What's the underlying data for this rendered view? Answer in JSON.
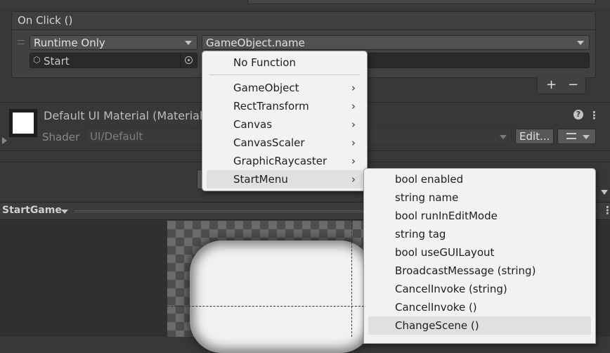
{
  "event": {
    "title": "On Click ()",
    "runtime_dropdown": "Runtime Only",
    "function_dropdown": "GameObject.name",
    "object_field": "Start",
    "add_button": "+",
    "remove_button": "−"
  },
  "material": {
    "title": "Default UI Material (Material)",
    "shader_label": "Shader",
    "shader_value": "UI/Default",
    "edit_button": "Edit..."
  },
  "scene": {
    "gameobject_dropdown": "StartGame"
  },
  "menu": {
    "items": [
      {
        "label": "No Function",
        "submenu": false
      },
      {
        "label": "GameObject",
        "submenu": true
      },
      {
        "label": "RectTransform",
        "submenu": true
      },
      {
        "label": "Canvas",
        "submenu": true
      },
      {
        "label": "CanvasScaler",
        "submenu": true
      },
      {
        "label": "GraphicRaycaster",
        "submenu": true
      },
      {
        "label": "StartMenu",
        "submenu": true,
        "highlighted": true
      }
    ]
  },
  "submenu": {
    "items": [
      {
        "label": "bool enabled"
      },
      {
        "label": "string name"
      },
      {
        "label": "bool runInEditMode"
      },
      {
        "label": "string tag"
      },
      {
        "label": "bool useGUILayout"
      },
      {
        "label": "BroadcastMessage (string)"
      },
      {
        "label": "CancelInvoke (string)"
      },
      {
        "label": "CancelInvoke ()"
      },
      {
        "label": "ChangeScene ()",
        "highlighted": true
      }
    ]
  },
  "colors": {
    "panel": "#383838",
    "field": "#2a2a2a",
    "menu": "#f2f2f2",
    "menu_highlight": "#e0e0e0"
  }
}
